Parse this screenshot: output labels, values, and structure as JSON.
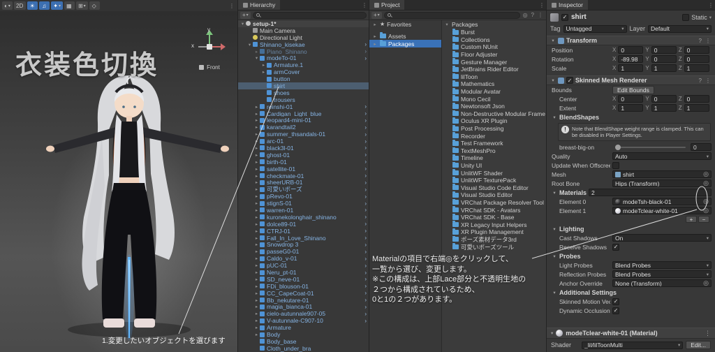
{
  "icons": {
    "picker": "◎",
    "dd": "▾",
    "fold_open": "▾",
    "fold_closed": "▸",
    "dots": "⋮",
    "help": "?",
    "plus": "+",
    "minus": "−",
    "check": "✓",
    "star": "★",
    "link": "∞",
    "warn": "!",
    "menu": "⋮",
    "open_arrow": "›"
  },
  "scene": {
    "title": "衣装色切換",
    "caption": "1.変更したいオブジェクトを選びます",
    "gizmo": {
      "x": "x",
      "y": "y",
      "front": "Front"
    },
    "toolbar": {
      "buttons": [
        {
          "g": "◐",
          "arrow": "▾"
        },
        {
          "g": "2D"
        },
        {
          "g": "☀",
          "cls": "on"
        },
        {
          "g": "♫",
          "cls": "on"
        },
        {
          "g": "✦",
          "cls": "on",
          "arrow": "▾"
        },
        {
          "g": "▦"
        },
        {
          "g": "⊞",
          "arrow": "▾"
        },
        {
          "g": "◇"
        }
      ],
      "menu": "⋮"
    }
  },
  "hierarchy": {
    "tab": "Hierarchy",
    "items": [
      {
        "label": "setup-1*",
        "depth": 0,
        "arrow": "▾",
        "cls": "scene"
      },
      {
        "label": "Main Camera",
        "depth": 1,
        "cls": "n cam"
      },
      {
        "label": "Directional Light",
        "depth": 1,
        "cls": "n sun"
      },
      {
        "label": "Shinano_kisekae",
        "depth": 1,
        "arrow": "▾",
        "cls": "p",
        "open": "›"
      },
      {
        "label": "Piano_Shinano",
        "depth": 2,
        "arrow": "▸",
        "cls": "p dim",
        "open": "›"
      },
      {
        "label": "modeTo-01",
        "depth": 2,
        "arrow": "▾",
        "cls": "p",
        "open": "›"
      },
      {
        "label": "Armature.1",
        "depth": 3,
        "arrow": "▸",
        "cls": "p"
      },
      {
        "label": "armCover",
        "depth": 3,
        "arrow": "▸",
        "cls": "p"
      },
      {
        "label": "button",
        "depth": 3,
        "cls": "p"
      },
      {
        "label": "shirt",
        "depth": 3,
        "cls": "p",
        "sel": true
      },
      {
        "label": "shoes",
        "depth": 3,
        "cls": "p"
      },
      {
        "label": "trousers",
        "depth": 3,
        "cls": "p"
      },
      {
        "label": "reinshi-01",
        "depth": 2,
        "arrow": "▸",
        "cls": "p",
        "open": "›"
      },
      {
        "label": "Cardigan_Light_blue",
        "depth": 2,
        "arrow": "▸",
        "cls": "p",
        "open": "›"
      },
      {
        "label": "leopard4-mini-01",
        "depth": 2,
        "arrow": "▸",
        "cls": "p",
        "open": "›"
      },
      {
        "label": "karandtail2",
        "depth": 2,
        "arrow": "▸",
        "cls": "p",
        "open": "›"
      },
      {
        "label": "summer_thsandals-01",
        "depth": 2,
        "arrow": "▸",
        "cls": "p",
        "open": "›"
      },
      {
        "label": "arc-01",
        "depth": 2,
        "arrow": "▸",
        "cls": "p",
        "open": "›"
      },
      {
        "label": "black3l-01",
        "depth": 2,
        "arrow": "▸",
        "cls": "p",
        "open": "›"
      },
      {
        "label": "ghost-01",
        "depth": 2,
        "arrow": "▸",
        "cls": "p",
        "open": "›"
      },
      {
        "label": "birth-01",
        "depth": 2,
        "arrow": "▸",
        "cls": "p",
        "open": "›"
      },
      {
        "label": "satellite-01",
        "depth": 2,
        "arrow": "▸",
        "cls": "p",
        "open": "›"
      },
      {
        "label": "checkmate-01",
        "depth": 2,
        "arrow": "▸",
        "cls": "p",
        "open": "›"
      },
      {
        "label": "sheerURB-01",
        "depth": 2,
        "arrow": "▸",
        "cls": "p",
        "open": "›"
      },
      {
        "label": "可愛いポーズ",
        "depth": 2,
        "arrow": "▸",
        "cls": "p",
        "open": "›"
      },
      {
        "label": "pRevo-01",
        "depth": 2,
        "arrow": "▸",
        "cls": "p",
        "open": "›"
      },
      {
        "label": "stignS-01",
        "depth": 2,
        "arrow": "▸",
        "cls": "p",
        "open": "›"
      },
      {
        "label": "warren-01",
        "depth": 2,
        "arrow": "▸",
        "cls": "p",
        "open": "›"
      },
      {
        "label": "kuronekolonghair_shinano",
        "depth": 2,
        "arrow": "▸",
        "cls": "p",
        "open": "›"
      },
      {
        "label": "dolce89-01",
        "depth": 2,
        "arrow": "▸",
        "cls": "p",
        "open": "›"
      },
      {
        "label": "CTRJ-01",
        "depth": 2,
        "arrow": "▸",
        "cls": "p",
        "open": "›"
      },
      {
        "label": "Fall_In_Love_Shinano",
        "depth": 2,
        "arrow": "▸",
        "cls": "p",
        "open": "›"
      },
      {
        "label": "Snowdrop 3",
        "depth": 2,
        "arrow": "▸",
        "cls": "p",
        "open": "›"
      },
      {
        "label": "passeG0-01",
        "depth": 2,
        "arrow": "▸",
        "cls": "p",
        "open": "›"
      },
      {
        "label": "Caldo_v-01",
        "depth": 2,
        "arrow": "▸",
        "cls": "p",
        "open": "›"
      },
      {
        "label": "pUC-01",
        "depth": 2,
        "arrow": "▸",
        "cls": "p",
        "open": "›"
      },
      {
        "label": "Neru_pt-01",
        "depth": 2,
        "arrow": "▸",
        "cls": "p",
        "open": "›"
      },
      {
        "label": "SD_neve-01",
        "depth": 2,
        "arrow": "▸",
        "cls": "p",
        "open": "›"
      },
      {
        "label": "FDi_blouson-01",
        "depth": 2,
        "arrow": "▸",
        "cls": "p",
        "open": "›"
      },
      {
        "label": "CC_CapeCoat-01",
        "depth": 2,
        "arrow": "▸",
        "cls": "p",
        "open": "›"
      },
      {
        "label": "Bb_nekutare-01",
        "depth": 2,
        "arrow": "▸",
        "cls": "p",
        "open": "›"
      },
      {
        "label": "magia_bianca-01",
        "depth": 2,
        "arrow": "▸",
        "cls": "p",
        "open": "›"
      },
      {
        "label": "cielo-autunnale907-05",
        "depth": 2,
        "arrow": "▸",
        "cls": "p",
        "open": "›"
      },
      {
        "label": "V-autunnale-C907-10",
        "depth": 2,
        "arrow": "▸",
        "cls": "p",
        "open": "›"
      },
      {
        "label": "Armature",
        "depth": 2,
        "arrow": "▸",
        "cls": "p"
      },
      {
        "label": "Body",
        "depth": 2,
        "arrow": "▸",
        "cls": "p"
      },
      {
        "label": "Body_base",
        "depth": 2,
        "cls": "p"
      },
      {
        "label": "Cloth_under_bra",
        "depth": 2,
        "cls": "p"
      }
    ]
  },
  "project": {
    "tab": "Project",
    "favorites_label": "Favorites",
    "assets_label": "Assets",
    "packages_label": "Packages",
    "list_header": "Packages",
    "packages": [
      "Burst",
      "Collections",
      "Custom NUnit",
      "Floor Adjuster",
      "Gesture Manager",
      "JetBrains Rider Editor",
      "lilToon",
      "Mathematics",
      "Modular Avatar",
      "Mono Cecil",
      "Newtonsoft Json",
      "Non-Destructive Modular Frame",
      "Oculus XR Plugin",
      "Post Processing",
      "Recorder",
      "Test Framework",
      "TextMeshPro",
      "Timeline",
      "Unity UI",
      "UnlitWF Shader",
      "UnlitWF TexturePack",
      "Visual Studio Code Editor",
      "Visual Studio Editor",
      "VRChat Package Resolver Tool",
      "VRChat SDK - Avatars",
      "VRChat SDK - Base",
      "XR Legacy Input Helpers",
      "XR Plugin Management",
      "ポーズ素材データ3rd",
      "可愛いポーズツール"
    ]
  },
  "annotation": {
    "lines": [
      "Materialの項目で右端◎をクリックして、",
      "一覧から選び、変更します。",
      "※この構成は、上部Lace部分と不透明生地の",
      "２つから構成されているため、",
      "0と1の２つがあります。"
    ]
  },
  "inspector": {
    "tab": "Inspector",
    "title": "shirt",
    "static_label": "Static",
    "tag_label": "Tag",
    "tag_value": "Untagged",
    "layer_label": "Layer",
    "layer_value": "Default",
    "axes": {
      "x": "X",
      "y": "Y",
      "z": "Z"
    },
    "transform": {
      "title": "Transform",
      "rows": [
        {
          "label": "Position",
          "x": "0",
          "y": "0",
          "z": "0"
        },
        {
          "label": "Rotation",
          "x": "-89.98",
          "y": "0",
          "z": "0"
        },
        {
          "label": "Scale",
          "x": "1",
          "y": "1",
          "z": "1"
        }
      ]
    },
    "smr": {
      "title": "Skinned Mesh Renderer",
      "bounds_label": "Bounds",
      "edit_bounds": "Edit Bounds",
      "bounds_rows": [
        {
          "label": "Center",
          "x": "0",
          "y": "0",
          "z": "0"
        },
        {
          "label": "Extent",
          "x": "1",
          "y": "1",
          "z": "1"
        }
      ],
      "blendshapes_label": "BlendShapes",
      "warning": "Note that BlendShape weight range is clamped. This can be disabled in Player Settings.",
      "blend_row_label": "breast-big-on",
      "blend_row_value": "0",
      "quality_label": "Quality",
      "quality_value": "Auto",
      "offscreen_label": "Update When Offscreen",
      "mesh_label": "Mesh",
      "mesh_value": "shirt",
      "rootbone_label": "Root Bone",
      "rootbone_value": "Hips (Transform)",
      "materials_label": "Materials",
      "materials_count": "2",
      "elements": [
        {
          "label": "Element 0",
          "value": "modeTsh-black-01",
          "ball": "dark"
        },
        {
          "label": "Element 1",
          "value": "modeTclear-white-01",
          "ball": "light"
        }
      ],
      "lighting_label": "Lighting",
      "cast_label": "Cast Shadows",
      "cast_value": "On",
      "receive_label": "Receive Shadows",
      "probes_label": "Probes",
      "light_probes_label": "Light Probes",
      "light_probes_value": "Blend Probes",
      "refl_probes_label": "Reflection Probes",
      "refl_probes_value": "Blend Probes",
      "anchor_label": "Anchor Override",
      "anchor_value": "None (Transform)",
      "addl_label": "Additional Settings",
      "motion_label": "Skinned Motion Vecto",
      "occlusion_label": "Dynamic Occlusion"
    },
    "material": {
      "title": "modeTclear-white-01 (Material)",
      "shader_label": "Shader",
      "shader_value": "_lil/lilToonMulti",
      "edit_button": "Edit..."
    }
  }
}
